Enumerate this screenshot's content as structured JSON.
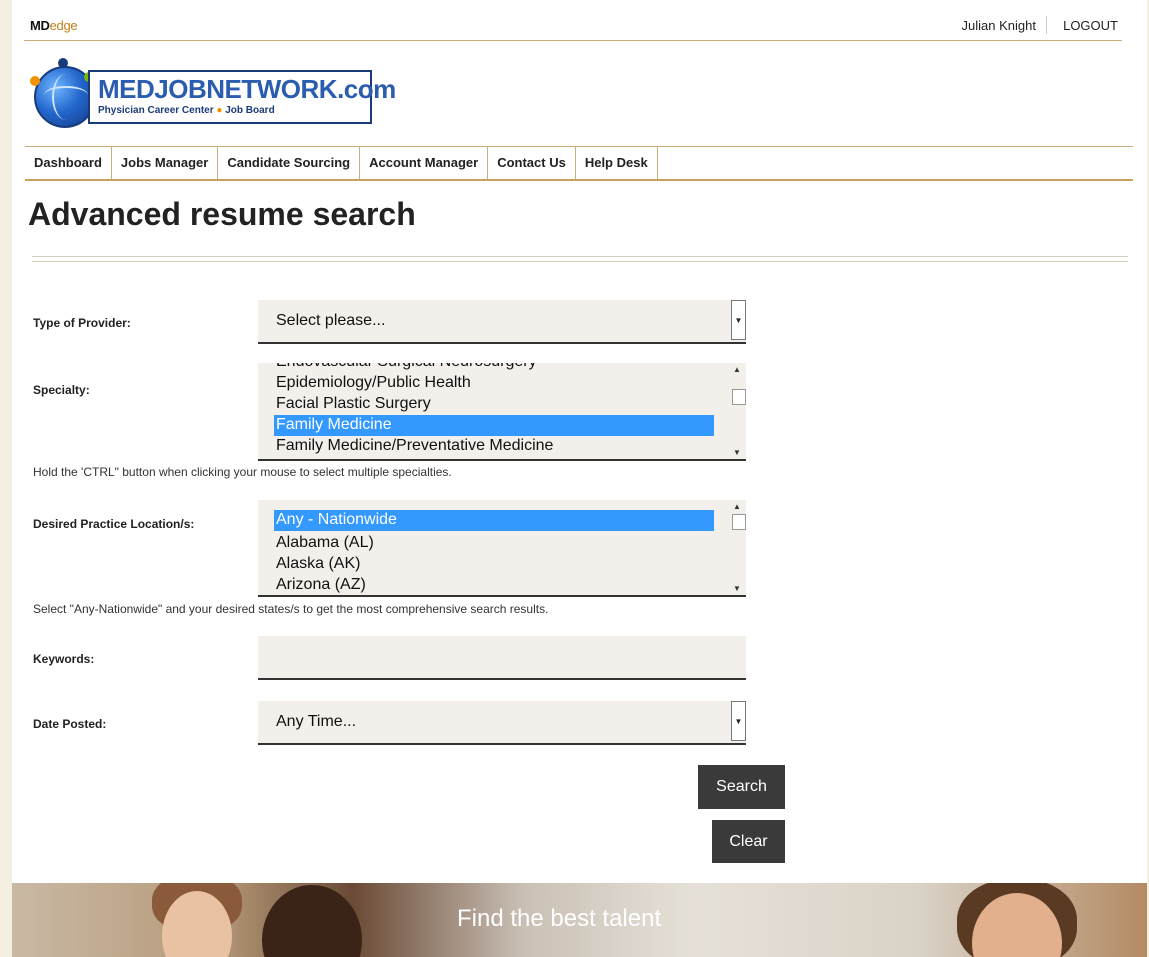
{
  "topbar": {
    "brand_md": "MD",
    "brand_edge": "edge",
    "user_name": "Julian Knight",
    "logout": "LOGOUT"
  },
  "logo": {
    "name": "MEDJOBNETWORK",
    "suffix": ".com",
    "tagline_left": "Physician Career Center",
    "tagline_dot": "●",
    "tagline_right": "Job Board"
  },
  "nav": [
    "Dashboard",
    "Jobs Manager",
    "Candidate Sourcing",
    "Account Manager",
    "Contact Us",
    "Help Desk"
  ],
  "page_title": "Advanced resume search",
  "form": {
    "provider_label": "Type of Provider:",
    "provider_value": "Select please...",
    "specialty_label": "Specialty:",
    "specialty_options": [
      "Endovascular Surgical Neurosurgery",
      "Epidemiology/Public Health",
      "Facial Plastic Surgery",
      "Family Medicine",
      "Family Medicine/Preventative Medicine"
    ],
    "specialty_selected": "Family Medicine",
    "specialty_hint": "Hold the 'CTRL\" button when clicking your mouse to select multiple specialties.",
    "location_label": "Desired Practice Location/s:",
    "location_options": [
      "Any - Nationwide",
      "Alabama (AL)",
      "Alaska (AK)",
      "Arizona (AZ)"
    ],
    "location_selected": "Any - Nationwide",
    "location_hint": "Select \"Any-Nationwide\" and your desired states/s to get the most comprehensive search results.",
    "keywords_label": "Keywords:",
    "keywords_value": "",
    "date_label": "Date Posted:",
    "date_value": "Any Time...",
    "search_button": "Search",
    "clear_button": "Clear"
  },
  "banner": {
    "title": "Find the best talent"
  },
  "colors": {
    "accent": "#c9a060",
    "button": "#3a3a3a",
    "selection": "#3399ff",
    "field_bg": "#f3f0eb"
  }
}
